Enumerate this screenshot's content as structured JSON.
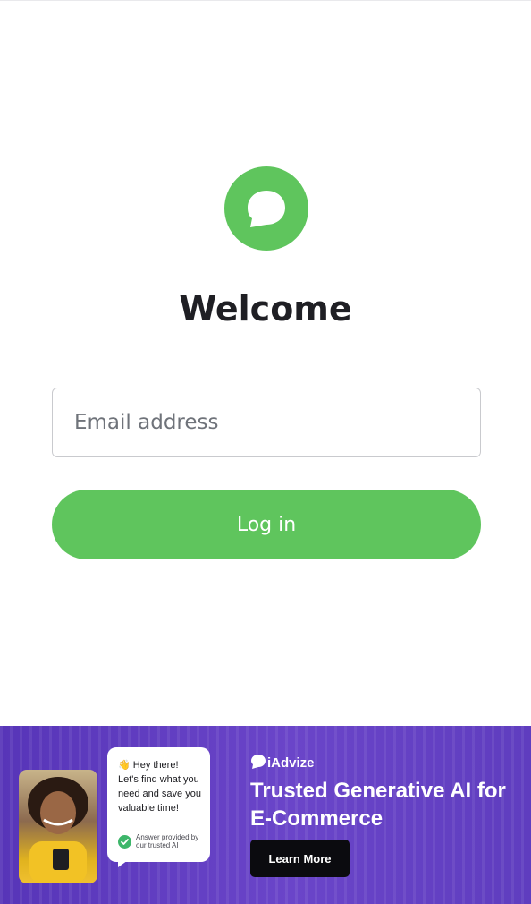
{
  "login": {
    "title": "Welcome",
    "email_placeholder": "Email address",
    "email_value": "",
    "button_label": "Log in",
    "brand_color": "#5fc55d"
  },
  "ad": {
    "bubble_line1": "Hey there!",
    "bubble_line2": "Let's find what you need and save you valuable time!",
    "answer_note": "Answer provided by our trusted AI",
    "brand": "iAdvize",
    "headline": "Trusted Generative AI for E-Commerce",
    "cta_label": "Learn More",
    "background_color": "#6441c4"
  },
  "icons": {
    "logo": "chat-bubble-icon",
    "wave": "waving-hand-icon",
    "check": "check-circle-icon",
    "brand": "speech-bubble-icon"
  }
}
